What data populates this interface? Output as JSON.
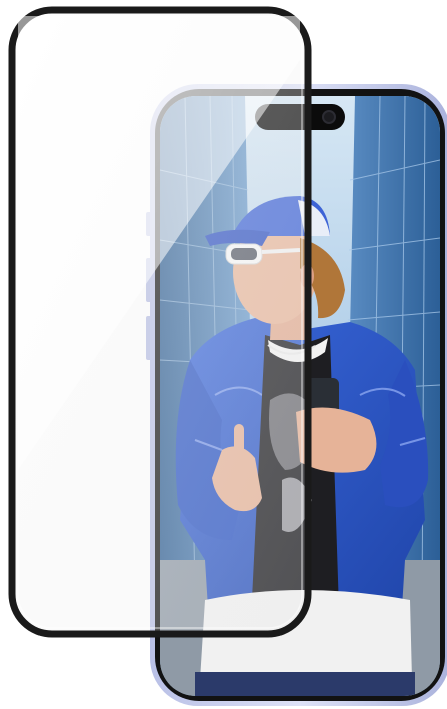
{
  "image": {
    "subject": "",
    "colors": {
      "background": "#ffffff",
      "phone_frame": "#c9cfee",
      "phone_bezel": "#111111",
      "sky": "#bcd8ee",
      "glass_building": "#3f77b4",
      "jacket": "#2a55c9",
      "cap": "#3d63d6",
      "skin": "#e8b79c",
      "hair": "#b47a3e",
      "shirt": "#f3f3f3",
      "protector_border": "#1a1a1a",
      "protector_fill": "#f4f4f4"
    },
    "icons": [
      "dynamic-island",
      "front-camera",
      "side-button"
    ]
  }
}
